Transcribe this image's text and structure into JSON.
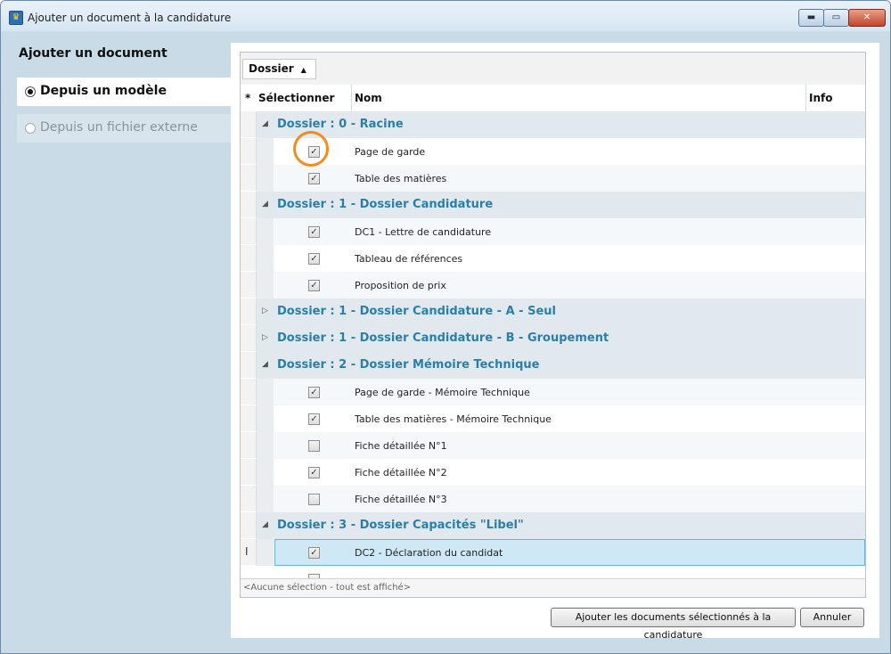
{
  "window": {
    "title": "Ajouter un document à la candidature"
  },
  "left": {
    "title": "Ajouter un document",
    "options": [
      {
        "label": "Depuis un modèle",
        "selected": true
      },
      {
        "label": "Depuis un fichier externe",
        "selected": false
      }
    ]
  },
  "grid": {
    "group_by": "Dossier",
    "columns": {
      "marker": "*",
      "select": "Sélectionner",
      "name": "Nom",
      "info": "Info"
    },
    "rows": [
      {
        "type": "group",
        "label": "Dossier : 0 - Racine",
        "expanded": true
      },
      {
        "type": "item",
        "checked": true,
        "name": "Page de garde"
      },
      {
        "type": "item",
        "checked": true,
        "name": "Table des matières"
      },
      {
        "type": "group",
        "label": "Dossier : 1 - Dossier Candidature",
        "expanded": true
      },
      {
        "type": "item",
        "checked": true,
        "name": "DC1 - Lettre de candidature"
      },
      {
        "type": "item",
        "checked": true,
        "name": "Tableau de références"
      },
      {
        "type": "item",
        "checked": true,
        "name": "Proposition de prix"
      },
      {
        "type": "group",
        "label": "Dossier : 1 - Dossier Candidature - A - Seul",
        "expanded": false
      },
      {
        "type": "group",
        "label": "Dossier : 1 - Dossier Candidature - B - Groupement",
        "expanded": false
      },
      {
        "type": "group",
        "label": "Dossier : 2 - Dossier Mémoire Technique",
        "expanded": true
      },
      {
        "type": "item",
        "checked": true,
        "name": "Page de garde - Mémoire Technique"
      },
      {
        "type": "item",
        "checked": true,
        "name": "Table des matières - Mémoire Technique"
      },
      {
        "type": "item",
        "checked": false,
        "name": "Fiche détaillée N°1"
      },
      {
        "type": "item",
        "checked": true,
        "name": "Fiche détaillée N°2"
      },
      {
        "type": "item",
        "checked": false,
        "name": "Fiche détaillée N°3"
      },
      {
        "type": "group",
        "label": "Dossier : 3 - Dossier Capacités \"Libel\"",
        "expanded": true
      },
      {
        "type": "item",
        "checked": true,
        "name": "DC2 - Déclaration du candidat",
        "current": true
      }
    ],
    "status": "<Aucune sélection - tout est affiché>"
  },
  "buttons": {
    "add": "Ajouter les documents sélectionnés à la candidature",
    "cancel": "Annuler"
  },
  "icons": {
    "app": "trophy-icon",
    "expanded": "triangle-down-icon",
    "collapsed": "triangle-right-icon",
    "sort": "sort-up-icon",
    "current_row": "text-cursor-icon"
  },
  "colors": {
    "group_text": "#2a7fa9",
    "highlight_ring": "#f28c1e",
    "selected_row": "#cfe8f6"
  }
}
